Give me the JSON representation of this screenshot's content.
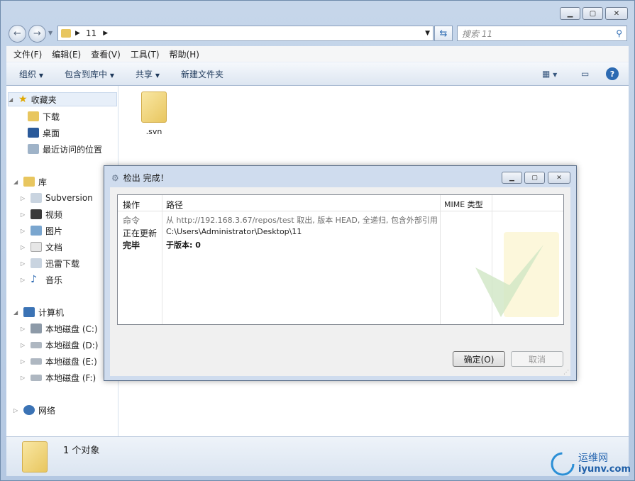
{
  "explorer": {
    "address": {
      "path_segment": "11"
    },
    "search": {
      "placeholder": "搜索 11"
    },
    "menu": [
      "文件(F)",
      "编辑(E)",
      "查看(V)",
      "工具(T)",
      "帮助(H)"
    ],
    "toolbar": {
      "organize": "组织",
      "include_in_library": "包含到库中",
      "share": "共享",
      "new_folder": "新建文件夹"
    },
    "nav": {
      "favorites": "收藏夹",
      "downloads": "下载",
      "desktop": "桌面",
      "recent": "最近访问的位置",
      "libraries": "库",
      "subversion": "Subversion",
      "videos": "视频",
      "pictures": "图片",
      "documents": "文档",
      "thunder": "迅雷下载",
      "music": "音乐",
      "computer": "计算机",
      "drive_c": "本地磁盘 (C:)",
      "drive_d": "本地磁盘 (D:)",
      "drive_e": "本地磁盘 (E:)",
      "drive_f": "本地磁盘 (F:)",
      "network": "网络"
    },
    "files": [
      {
        "name": ".svn"
      }
    ],
    "status": {
      "count": "1 个对象"
    }
  },
  "dialog": {
    "title": "检出 完成！",
    "headers": {
      "action": "操作",
      "path": "路径",
      "mime": "MIME 类型"
    },
    "rows": [
      {
        "action": "命令",
        "path": "从 http://192.168.3.67/repos/test 取出, 版本 HEAD, 全递归, 包含外部引用"
      },
      {
        "action": "正在更新",
        "path": "C:\\Users\\Administrator\\Desktop\\11"
      },
      {
        "action": "完毕",
        "path": "于版本: 0"
      }
    ],
    "ok_label": "确定(O)",
    "cancel_label": "取消"
  },
  "watermark": {
    "brand": "运维网",
    "url": "iyunv.com"
  },
  "colors": {
    "accent": "#2c6ab2",
    "folder": "#e8c65f"
  }
}
